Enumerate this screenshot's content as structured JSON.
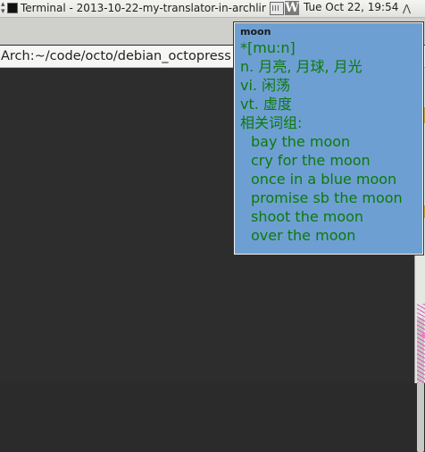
{
  "panel": {
    "terminal_task": "Terminal - 2013-10-22-my-translator-in-archlinu...",
    "clock": "Tue Oct 22, 19:54",
    "tray_app_letter": "W"
  },
  "terminal": {
    "prompt": "Arch:~/code/octo/debian_octopress"
  },
  "dict": {
    "word": "moon",
    "phonetic": "*[mu:n]",
    "definitions": [
      "n. 月亮, 月球, 月光",
      "vi. 闲荡",
      "vt. 虚度"
    ],
    "phrases_heading": "相关词组:",
    "phrases": [
      "bay the moon",
      "cry for the moon",
      "once in a blue moon",
      "promise sb the moon",
      "shoot the moon",
      "over the moon"
    ]
  },
  "colors": {
    "popup_bg": "#6e9fd2",
    "popup_text": "#0b7a0b",
    "terminal_bg": "#2d2d2d"
  }
}
